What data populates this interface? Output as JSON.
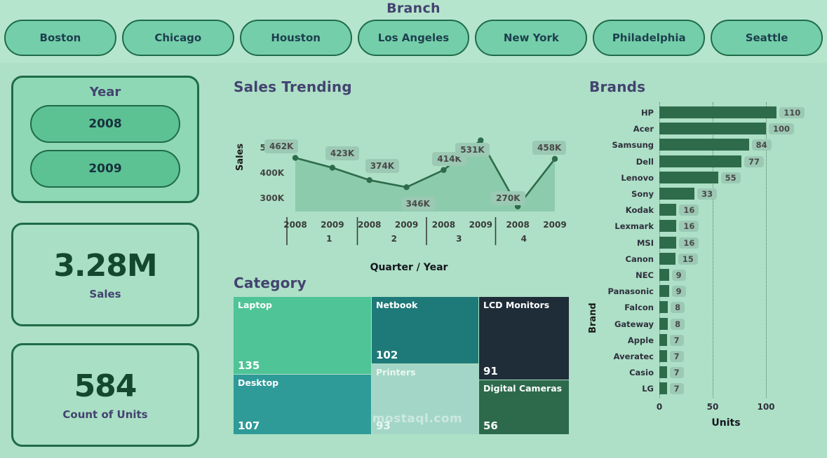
{
  "header": {
    "title": "Branch",
    "branches": [
      "Boston",
      "Chicago",
      "Houston",
      "Los Angeles",
      "New York",
      "Philadelphia",
      "Seattle"
    ]
  },
  "sidebar": {
    "year_filter": {
      "title": "Year",
      "options": [
        "2008",
        "2009"
      ]
    },
    "kpis": [
      {
        "value": "3.28M",
        "label": "Sales"
      },
      {
        "value": "584",
        "label": "Count of Units"
      }
    ]
  },
  "panels": {
    "trending_title": "Sales Trending",
    "category_title": "Category",
    "brands_title": "Brands"
  },
  "watermark": "mostaql.com",
  "colors": {
    "page_bg": "#ade0c6",
    "header_bg": "#b6e5cd",
    "outline": "#1f6b48",
    "title": "#434370",
    "line": "#2e6b4b",
    "area": "#8ccbac",
    "bar": "#2e6b4b",
    "label_bg": "#9cc9b4"
  },
  "chart_data": [
    {
      "type": "area",
      "title": "Sales Trending",
      "xlabel": "Quarter / Year",
      "ylabel": "Sales",
      "ylim": [
        250000,
        560000
      ],
      "yticks": [
        "300K",
        "400K",
        "500K"
      ],
      "grid": false,
      "quarters": [
        "1",
        "2",
        "3",
        "4"
      ],
      "years": [
        "2008",
        "2009"
      ],
      "categories": [
        "2008 Q1",
        "2009 Q1",
        "2008 Q2",
        "2009 Q2",
        "2008 Q3",
        "2009 Q3",
        "2008 Q4",
        "2009 Q4"
      ],
      "values": [
        462000,
        423000,
        374000,
        346000,
        414000,
        531000,
        270000,
        458000
      ],
      "labels": [
        "462K",
        "423K",
        "374K",
        "346K",
        "414K",
        "531K",
        "270K",
        "458K"
      ]
    },
    {
      "type": "treemap",
      "title": "Category",
      "tiles": [
        {
          "name": "Laptop",
          "value": "135",
          "color": "#4fc496"
        },
        {
          "name": "Desktop",
          "value": "107",
          "color": "#2e9b98"
        },
        {
          "name": "Netbook",
          "value": "102",
          "color": "#1e7a79"
        },
        {
          "name": "Printers",
          "value": "93",
          "color": "#a3d6c6"
        },
        {
          "name": "LCD Monitors",
          "value": "91",
          "color": "#1f2d38"
        },
        {
          "name": "Digital Cameras",
          "value": "56",
          "color": "#2d6a4b"
        }
      ]
    },
    {
      "type": "bar",
      "orientation": "horizontal",
      "title": "Brands",
      "xlabel": "Units",
      "ylabel": "Brand",
      "xlim": [
        0,
        120
      ],
      "xticks": [
        "0",
        "50",
        "100"
      ],
      "grid": true,
      "categories": [
        "HP",
        "Acer",
        "Samsung",
        "Dell",
        "Lenovo",
        "Sony",
        "Kodak",
        "Lexmark",
        "MSI",
        "Canon",
        "NEC",
        "Panasonic",
        "Falcon",
        "Gateway",
        "Apple",
        "Averatec",
        "Casio",
        "LG"
      ],
      "values": [
        110,
        100,
        84,
        77,
        55,
        33,
        16,
        16,
        16,
        15,
        9,
        9,
        8,
        8,
        7,
        7,
        7,
        7
      ]
    }
  ]
}
